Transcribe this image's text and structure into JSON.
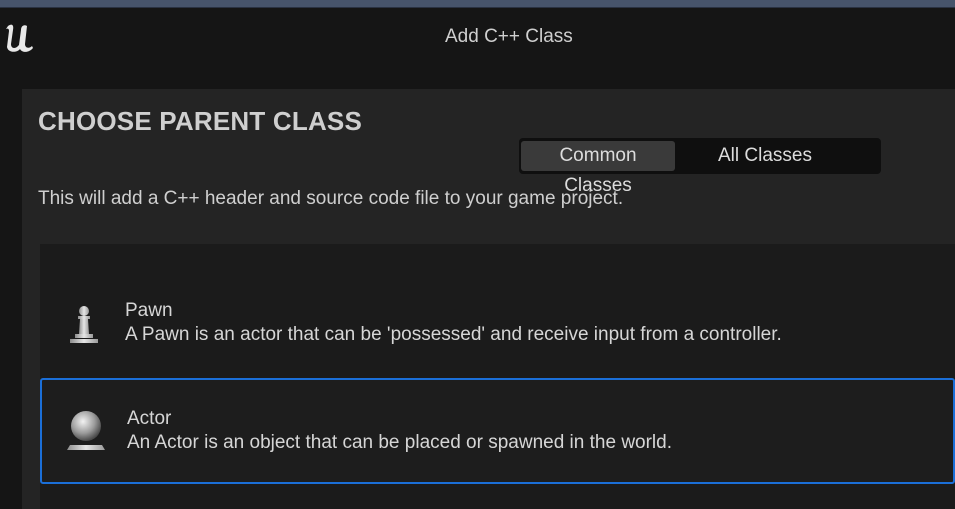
{
  "window": {
    "title": "Add C++ Class"
  },
  "panel": {
    "heading": "CHOOSE PARENT CLASS",
    "description": "This will add a C++ header and source code file to your game project.",
    "tabs": [
      {
        "label": "Common Classes",
        "active": true
      },
      {
        "label": "All Classes",
        "active": false
      }
    ]
  },
  "classes": [
    {
      "name": "Pawn",
      "description": "A Pawn is an actor that can be 'possessed' and receive input from a controller.",
      "icon": "pawn-icon",
      "selected": false
    },
    {
      "name": "Actor",
      "description": "An Actor is an object that can be placed or spawned in the world.",
      "icon": "actor-icon",
      "selected": true
    }
  ],
  "colors": {
    "selection_border": "#1b6fd8",
    "panel_bg": "#242424",
    "list_bg": "#1b1b1b"
  }
}
